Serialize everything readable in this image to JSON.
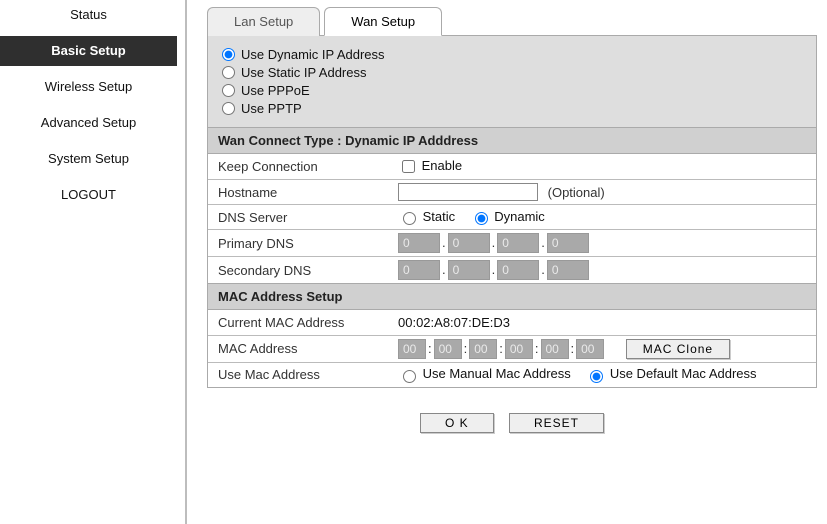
{
  "sidebar": {
    "items": [
      {
        "label": "Status",
        "active": false
      },
      {
        "label": "Basic Setup",
        "active": true
      },
      {
        "label": "Wireless Setup",
        "active": false
      },
      {
        "label": "Advanced Setup",
        "active": false
      },
      {
        "label": "System Setup",
        "active": false
      },
      {
        "label": "LOGOUT",
        "active": false
      }
    ]
  },
  "tabs": {
    "lan": "Lan Setup",
    "wan": "Wan Setup"
  },
  "connection_type": {
    "options": {
      "dynamic": "Use Dynamic IP Address",
      "static": "Use Static IP Address",
      "pppoe": "Use PPPoE",
      "pptp": "Use PPTP"
    },
    "selected": "dynamic"
  },
  "sections": {
    "wan_header": "Wan Connect Type : Dynamic IP Adddress",
    "mac_header": "MAC Address Setup"
  },
  "fields": {
    "keep_connection_label": "Keep Connection",
    "keep_connection_enable": "Enable",
    "keep_connection_checked": false,
    "hostname_label": "Hostname",
    "hostname_value": "",
    "hostname_optional": "(Optional)",
    "dns_server_label": "DNS Server",
    "dns_static": "Static",
    "dns_dynamic": "Dynamic",
    "dns_selected": "dynamic",
    "primary_dns_label": "Primary DNS",
    "primary_dns": [
      "0",
      "0",
      "0",
      "0"
    ],
    "secondary_dns_label": "Secondary DNS",
    "secondary_dns": [
      "0",
      "0",
      "0",
      "0"
    ],
    "current_mac_label": "Current MAC Address",
    "current_mac": "00:02:A8:07:DE:D3",
    "mac_address_label": "MAC Address",
    "mac_address": [
      "00",
      "00",
      "00",
      "00",
      "00",
      "00"
    ],
    "mac_clone_btn": "MAC Clone",
    "use_mac_label": "Use Mac Address",
    "use_manual_mac": "Use Manual Mac Address",
    "use_default_mac": "Use Default Mac Address",
    "use_mac_selected": "default"
  },
  "buttons": {
    "ok": "O K",
    "reset": "RESET"
  }
}
